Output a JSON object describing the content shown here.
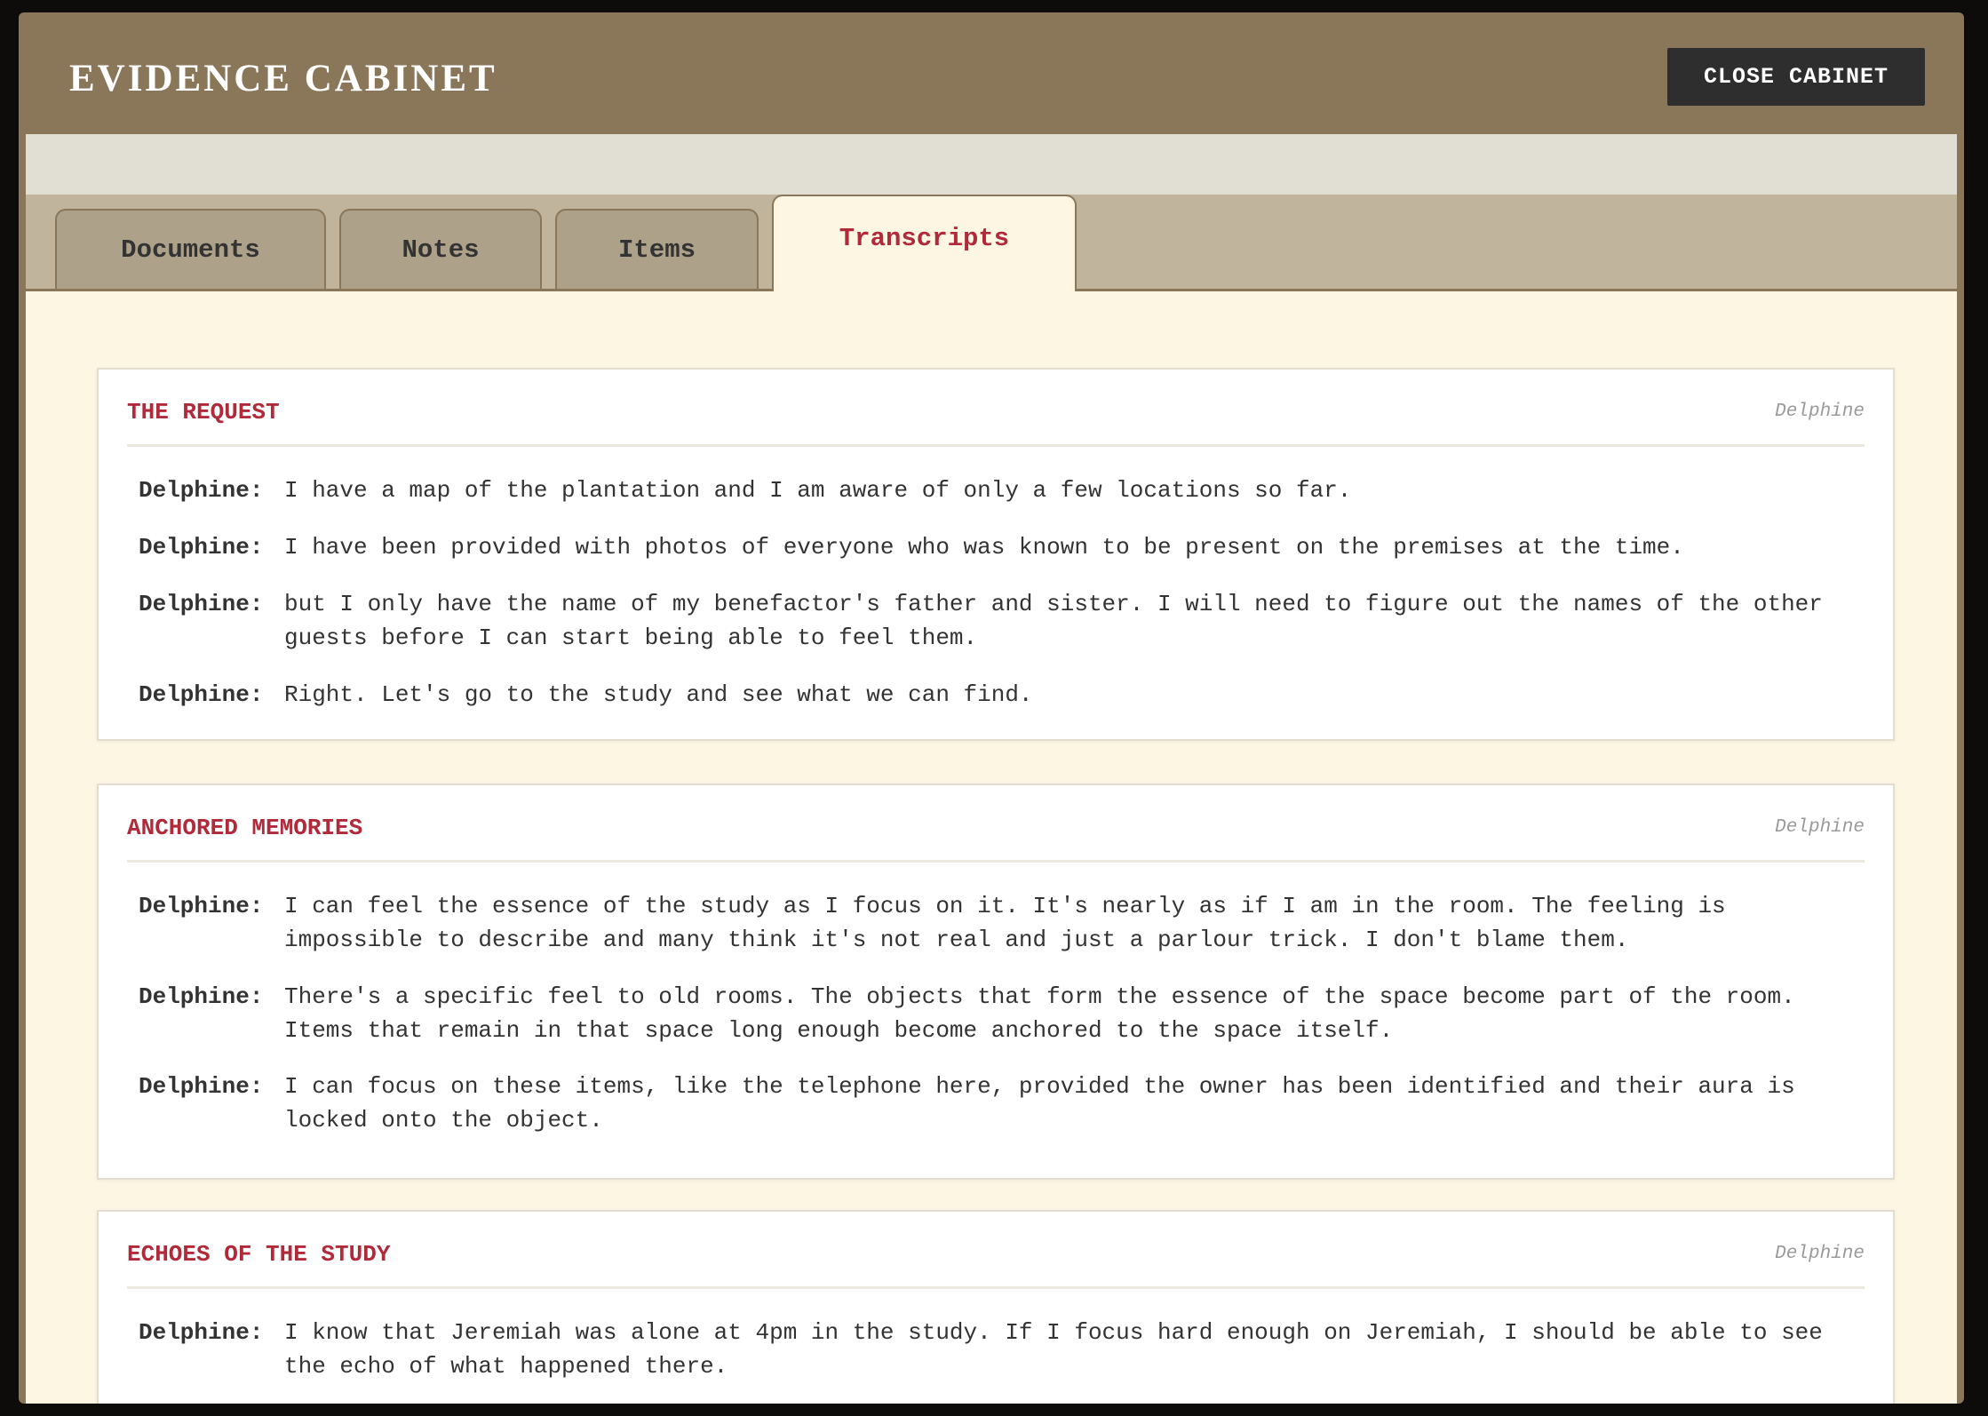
{
  "header": {
    "title": "EVIDENCE CABINET",
    "close_label": "CLOSE CABINET"
  },
  "tabs": [
    {
      "label": "Documents",
      "active": false
    },
    {
      "label": "Notes",
      "active": false
    },
    {
      "label": "Items",
      "active": false
    },
    {
      "label": "Transcripts",
      "active": true
    }
  ],
  "transcripts": [
    {
      "title": "THE REQUEST",
      "speaker": "Delphine",
      "lines": [
        {
          "who": "Delphine:",
          "text": "I have a map of the plantation and I am aware of only a few locations so far."
        },
        {
          "who": "Delphine:",
          "text": "I have been provided with photos of everyone who was known to be present on the premises at the time."
        },
        {
          "who": "Delphine:",
          "text": "but I only have the name of my benefactor's father and sister. I will need to figure out the names of the other guests before I can start being able to feel them."
        },
        {
          "who": "Delphine:",
          "text": "Right. Let's go to the study and see what we can find."
        }
      ]
    },
    {
      "title": "ANCHORED MEMORIES",
      "speaker": "Delphine",
      "lines": [
        {
          "who": "Delphine:",
          "text": "I can feel the essence of the study as I focus on it. It's nearly as if I am in the room. The feeling is impossible to describe and many think it's not real and just a parlour trick. I don't blame them."
        },
        {
          "who": "Delphine:",
          "text": "There's a specific feel to old rooms. The objects that form the essence of the space become part of the room. Items that remain in that space long enough become anchored to the space itself."
        },
        {
          "who": "Delphine:",
          "text": "I can focus on these items, like the telephone here, provided the owner has been identified and their aura is locked onto the object."
        }
      ]
    },
    {
      "title": "ECHOES OF THE STUDY",
      "speaker": "Delphine",
      "lines": [
        {
          "who": "Delphine:",
          "text": "I know that Jeremiah was alone at 4pm in the study. If I focus hard enough on Jeremiah, I should be able to see the echo of what happened there."
        }
      ]
    }
  ]
}
